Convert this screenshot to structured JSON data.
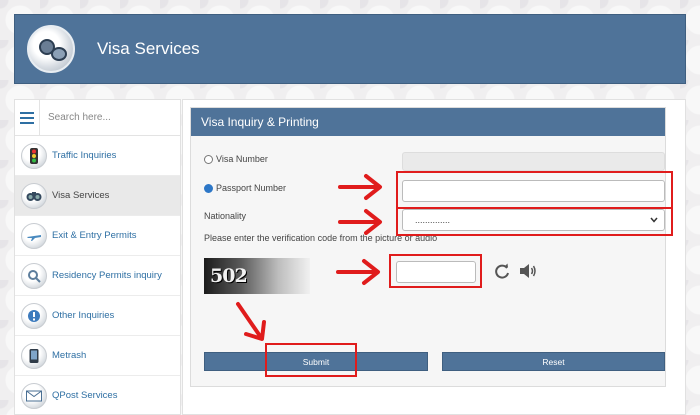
{
  "header": {
    "title": "Visa Services",
    "logo_icon": "binoculars-logo"
  },
  "sidebar": {
    "search_placeholder": "Search here...",
    "items": [
      {
        "label": "Traffic Inquiries",
        "icon": "traffic-light-icon"
      },
      {
        "label": "Visa Services",
        "icon": "binoculars-icon",
        "active": true
      },
      {
        "label": "Exit & Entry Permits",
        "icon": "airplane-icon"
      },
      {
        "label": "Residency Permits inquiry",
        "icon": "magnifier-icon"
      },
      {
        "label": "Other Inquiries",
        "icon": "info-icon"
      },
      {
        "label": "Metrash",
        "icon": "phone-icon"
      },
      {
        "label": "QPost Services",
        "icon": "mail-icon"
      }
    ]
  },
  "form": {
    "title": "Visa Inquiry & Printing",
    "visa_number_label": "Visa Number",
    "passport_number_label": "Passport Number",
    "nationality_label": "Nationality",
    "nationality_value": "..............",
    "verification_text": "Please enter the verification code from the picture or audio",
    "captcha_text": "502",
    "submit_label": "Submit",
    "reset_label": "Reset"
  },
  "colors": {
    "header": "#4f7399",
    "annotation": "#e01c1c",
    "link": "#2e6fa3"
  }
}
